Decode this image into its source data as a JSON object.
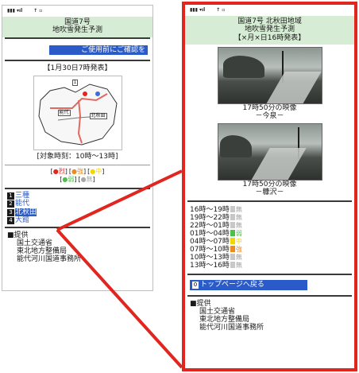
{
  "left": {
    "status": {
      "signal": "▮▮▮ ▾ıl",
      "icons": "↑ ▫"
    },
    "title_lines": [
      "国道7号",
      "地吹雪発生予測"
    ],
    "notice_link": "ご使用前にご確認を",
    "issued": "【1月30日7時発表】",
    "map_labels": [
      "能代",
      "北秋田",
      "三種",
      "大館"
    ],
    "target_time": "[対象時刻：10時～13時]",
    "legend": [
      {
        "label": "烈",
        "color": "#e0261f"
      },
      {
        "label": "強",
        "color": "#f08a1c"
      },
      {
        "label": "中",
        "color": "#f2d600"
      },
      {
        "label": "弱",
        "color": "#4cc04a"
      },
      {
        "label": "無",
        "color": "#a8a8a8"
      }
    ],
    "routes": [
      {
        "num": "1",
        "name": "三種"
      },
      {
        "num": "2",
        "name": "能代"
      },
      {
        "num": "3",
        "name": "北秋田"
      },
      {
        "num": "4",
        "name": "大館"
      }
    ],
    "provider_title": "■提供",
    "provider_lines": [
      "国土交通省",
      "東北地方整備局",
      "能代河川国道事務所"
    ]
  },
  "right": {
    "status": {
      "signal": "▮▮▮ ▾ıl",
      "icons": "↑ ▫"
    },
    "title_lines": [
      "国道7号 北秋田地域",
      "地吹雪発生予測",
      "【×月×日16時発表】"
    ],
    "cameras": [
      {
        "time": "17時50分の映像",
        "place": "－今泉－"
      },
      {
        "time": "17時50分の映像",
        "place": "－糠沢－"
      }
    ],
    "schedule": [
      {
        "time": "16時～19時",
        "level": "無",
        "color": "#c8c8c8"
      },
      {
        "time": "19時～22時",
        "level": "無",
        "color": "#c8c8c8"
      },
      {
        "time": "22時～01時",
        "level": "無",
        "color": "#c8c8c8"
      },
      {
        "time": "01時～04時",
        "level": "弱",
        "color": "#4cc04a"
      },
      {
        "time": "04時～07時",
        "level": "中",
        "color": "#f2d600"
      },
      {
        "time": "07時～10時",
        "level": "強",
        "color": "#f08a1c"
      },
      {
        "time": "10時～13時",
        "level": "無",
        "color": "#c8c8c8"
      },
      {
        "time": "13時～16時",
        "level": "無",
        "color": "#c8c8c8"
      }
    ],
    "top_link": {
      "num": "0",
      "label": "トップページへ戻る"
    },
    "provider_title": "■提供",
    "provider_lines": [
      "国土交通省",
      "東北地方整備局",
      "能代河川国道事務所"
    ]
  }
}
